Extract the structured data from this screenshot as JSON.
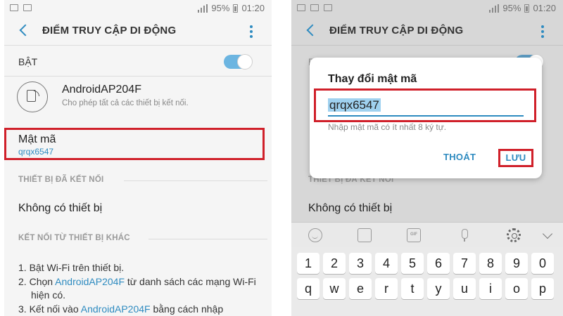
{
  "status": {
    "battery": "95%",
    "time": "01:20"
  },
  "left": {
    "title": "ĐIỂM TRUY CẬP DI ĐỘNG",
    "toggle_label": "BẬT",
    "toggle_on": true,
    "ap_name": "AndroidAP204F",
    "ap_desc": "Cho phép tất cả các thiết bị kết nối.",
    "password_label": "Mật mã",
    "password_value": "qrqx6547",
    "connected_header": "THIẾT BỊ ĐÃ KẾT NỐI",
    "no_devices": "Không có thiết bị",
    "connect_header": "KẾT NỐI TỪ THIẾT BỊ KHÁC",
    "steps": [
      {
        "num": "1.",
        "pre": "Bật Wi-Fi trên thiết bị.",
        "hl": "",
        "post": ""
      },
      {
        "num": "2.",
        "pre": "Chọn ",
        "hl": "AndroidAP204F",
        "post": " từ danh sách các mạng Wi-Fi hiện có."
      },
      {
        "num": "3.",
        "pre": "Kết nối vào ",
        "hl": "AndroidAP204F",
        "post": " bằng cách nhập"
      }
    ]
  },
  "right": {
    "title": "ĐIỂM TRUY CẬP DI ĐỘNG",
    "behind_toggle_label": "B",
    "behind_connected_header": "THIẾT BỊ ĐÃ KẾT NỐI",
    "no_devices": "Không có thiết bị",
    "dialog": {
      "title": "Thay đổi mật mã",
      "input_value": "qrqx6547",
      "hint": "Nhập mật mã có ít nhất 8 ký tự.",
      "cancel": "THOÁT",
      "save": "LƯU"
    },
    "keyboard": {
      "toolbar_icons": [
        "emoji-icon",
        "sticker-icon",
        "gif-icon",
        "mic-icon",
        "gear-icon",
        "chevron-down-icon"
      ],
      "gif_label": "GIF",
      "row1": [
        "1",
        "2",
        "3",
        "4",
        "5",
        "6",
        "7",
        "8",
        "9",
        "0"
      ],
      "row2": [
        "q",
        "w",
        "e",
        "r",
        "t",
        "y",
        "u",
        "i",
        "o",
        "p"
      ]
    }
  },
  "colors": {
    "accent": "#2e8bc0",
    "highlight_box": "#d0202a",
    "toggle": "#6cb5e1"
  }
}
